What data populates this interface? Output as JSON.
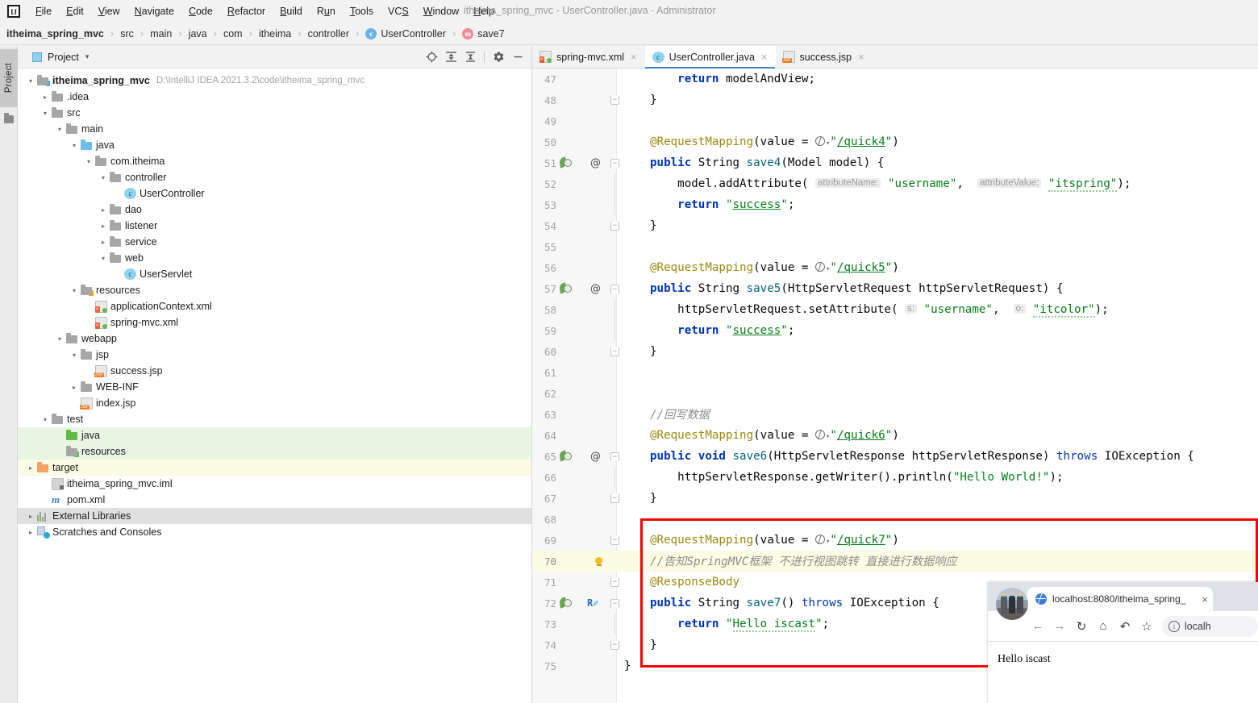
{
  "window": {
    "title": "itheima_spring_mvc - UserController.java - Administrator",
    "logo_text": "IJ"
  },
  "menubar": {
    "items": [
      {
        "label": "File",
        "mnemonic": "F"
      },
      {
        "label": "Edit",
        "mnemonic": "E"
      },
      {
        "label": "View",
        "mnemonic": "V"
      },
      {
        "label": "Navigate",
        "mnemonic": "N"
      },
      {
        "label": "Code",
        "mnemonic": "C"
      },
      {
        "label": "Refactor",
        "mnemonic": "R"
      },
      {
        "label": "Build",
        "mnemonic": "B"
      },
      {
        "label": "Run",
        "mnemonic": "u"
      },
      {
        "label": "Tools",
        "mnemonic": "T"
      },
      {
        "label": "VCS",
        "mnemonic": "S"
      },
      {
        "label": "Window",
        "mnemonic": "W"
      },
      {
        "label": "Help",
        "mnemonic": "H"
      }
    ]
  },
  "breadcrumb": {
    "items": [
      {
        "label": "itheima_spring_mvc",
        "bold": true,
        "badge": ""
      },
      {
        "label": "src",
        "bold": false,
        "badge": ""
      },
      {
        "label": "main",
        "bold": false,
        "badge": ""
      },
      {
        "label": "java",
        "bold": false,
        "badge": ""
      },
      {
        "label": "com",
        "bold": false,
        "badge": ""
      },
      {
        "label": "itheima",
        "bold": false,
        "badge": ""
      },
      {
        "label": "controller",
        "bold": false,
        "badge": ""
      },
      {
        "label": "UserController",
        "bold": false,
        "badge": "c"
      },
      {
        "label": "save7",
        "bold": false,
        "badge": "m"
      }
    ]
  },
  "left_strip": {
    "project_tab_label": "Project"
  },
  "project_panel": {
    "title": "Project",
    "caret": "▾",
    "toolbar": [
      {
        "name": "locate-icon",
        "glyph": "⊕"
      },
      {
        "name": "expand-all-icon",
        "glyph": "≡"
      },
      {
        "name": "collapse-all-icon",
        "glyph": "≡"
      },
      {
        "name": "settings-gear-icon",
        "glyph": "⚙"
      },
      {
        "name": "hide-icon",
        "glyph": "—"
      }
    ],
    "tree": [
      {
        "indent": 0,
        "arrow": "⌄",
        "icon": "folder-src",
        "label": "itheima_spring_mvc",
        "bold": true,
        "path": "D:\\IntelliJ IDEA 2021.3.2\\code\\itheima_spring_mvc",
        "bg": ""
      },
      {
        "indent": 1,
        "arrow": "›",
        "icon": "folder",
        "label": ".idea",
        "bold": false,
        "path": "",
        "bg": ""
      },
      {
        "indent": 1,
        "arrow": "⌄",
        "icon": "folder",
        "label": "src",
        "bold": false,
        "path": "",
        "bg": ""
      },
      {
        "indent": 2,
        "arrow": "⌄",
        "icon": "folder",
        "label": "main",
        "bold": false,
        "path": "",
        "bg": ""
      },
      {
        "indent": 3,
        "arrow": "⌄",
        "icon": "folder-blue",
        "label": "java",
        "bold": false,
        "path": "",
        "bg": ""
      },
      {
        "indent": 4,
        "arrow": "⌄",
        "icon": "package",
        "label": "com.itheima",
        "bold": false,
        "path": "",
        "bg": ""
      },
      {
        "indent": 5,
        "arrow": "⌄",
        "icon": "package",
        "label": "controller",
        "bold": false,
        "path": "",
        "bg": ""
      },
      {
        "indent": 6,
        "arrow": "",
        "icon": "class",
        "label": "UserController",
        "bold": false,
        "path": "",
        "bg": ""
      },
      {
        "indent": 5,
        "arrow": "›",
        "icon": "package",
        "label": "dao",
        "bold": false,
        "path": "",
        "bg": ""
      },
      {
        "indent": 5,
        "arrow": "›",
        "icon": "package",
        "label": "listener",
        "bold": false,
        "path": "",
        "bg": ""
      },
      {
        "indent": 5,
        "arrow": "›",
        "icon": "package",
        "label": "service",
        "bold": false,
        "path": "",
        "bg": ""
      },
      {
        "indent": 5,
        "arrow": "⌄",
        "icon": "package",
        "label": "web",
        "bold": false,
        "path": "",
        "bg": ""
      },
      {
        "indent": 6,
        "arrow": "",
        "icon": "class",
        "label": "UserServlet",
        "bold": false,
        "path": "",
        "bg": ""
      },
      {
        "indent": 3,
        "arrow": "⌄",
        "icon": "folder-res",
        "label": "resources",
        "bold": false,
        "path": "",
        "bg": ""
      },
      {
        "indent": 4,
        "arrow": "",
        "icon": "xml",
        "label": "applicationContext.xml",
        "bold": false,
        "path": "",
        "bg": ""
      },
      {
        "indent": 4,
        "arrow": "",
        "icon": "xml",
        "label": "spring-mvc.xml",
        "bold": false,
        "path": "",
        "bg": ""
      },
      {
        "indent": 2,
        "arrow": "⌄",
        "icon": "webapp",
        "label": "webapp",
        "bold": false,
        "path": "",
        "bg": ""
      },
      {
        "indent": 3,
        "arrow": "⌄",
        "icon": "folder",
        "label": "jsp",
        "bold": false,
        "path": "",
        "bg": ""
      },
      {
        "indent": 4,
        "arrow": "",
        "icon": "jsp",
        "label": "success.jsp",
        "bold": false,
        "path": "",
        "bg": ""
      },
      {
        "indent": 3,
        "arrow": "›",
        "icon": "folder",
        "label": "WEB-INF",
        "bold": false,
        "path": "",
        "bg": ""
      },
      {
        "indent": 3,
        "arrow": "",
        "icon": "jsp",
        "label": "index.jsp",
        "bold": false,
        "path": "",
        "bg": ""
      },
      {
        "indent": 1,
        "arrow": "⌄",
        "icon": "folder",
        "label": "test",
        "bold": false,
        "path": "",
        "bg": ""
      },
      {
        "indent": 2,
        "arrow": "",
        "icon": "folder-green",
        "label": "java",
        "bold": false,
        "path": "",
        "bg": "green"
      },
      {
        "indent": 2,
        "arrow": "",
        "icon": "folder-testres",
        "label": "resources",
        "bold": false,
        "path": "",
        "bg": "green"
      },
      {
        "indent": 0,
        "arrow": "›",
        "icon": "folder-orange",
        "label": "target",
        "bold": false,
        "path": "",
        "bg": "yellow"
      },
      {
        "indent": 1,
        "arrow": "",
        "icon": "iml",
        "label": "itheima_spring_mvc.iml",
        "bold": false,
        "path": "",
        "bg": ""
      },
      {
        "indent": 1,
        "arrow": "",
        "icon": "maven",
        "label": "pom.xml",
        "bold": false,
        "path": "",
        "bg": ""
      },
      {
        "indent": -1,
        "arrow": "›",
        "icon": "libs",
        "label": "External Libraries",
        "bold": false,
        "path": "",
        "bg": "gray"
      },
      {
        "indent": -1,
        "arrow": "›",
        "icon": "scratch",
        "label": "Scratches and Consoles",
        "bold": false,
        "path": "",
        "bg": ""
      }
    ]
  },
  "editor": {
    "tabs": [
      {
        "label": "spring-mvc.xml",
        "icon": "xml",
        "active": false,
        "close": "×"
      },
      {
        "label": "UserController.java",
        "icon": "class",
        "active": true,
        "close": "×"
      },
      {
        "label": "success.jsp",
        "icon": "jsp",
        "active": false,
        "close": "×"
      }
    ],
    "first_line_number": 47,
    "lines": [
      {
        "n": "47",
        "gutter": "",
        "fold": "",
        "highlight": false
      },
      {
        "n": "48",
        "gutter": "",
        "fold": "bot",
        "highlight": false
      },
      {
        "n": "49",
        "gutter": "",
        "fold": "",
        "highlight": false
      },
      {
        "n": "50",
        "gutter": "",
        "fold": "",
        "highlight": false
      },
      {
        "n": "51",
        "gutter": "bean-at",
        "fold": "top",
        "highlight": false
      },
      {
        "n": "52",
        "gutter": "",
        "fold": "bar",
        "highlight": false
      },
      {
        "n": "53",
        "gutter": "",
        "fold": "bar",
        "highlight": false
      },
      {
        "n": "54",
        "gutter": "",
        "fold": "bot",
        "highlight": false
      },
      {
        "n": "55",
        "gutter": "",
        "fold": "",
        "highlight": false
      },
      {
        "n": "56",
        "gutter": "",
        "fold": "",
        "highlight": false
      },
      {
        "n": "57",
        "gutter": "bean-at",
        "fold": "top",
        "highlight": false
      },
      {
        "n": "58",
        "gutter": "",
        "fold": "bar",
        "highlight": false
      },
      {
        "n": "59",
        "gutter": "",
        "fold": "bar",
        "highlight": false
      },
      {
        "n": "60",
        "gutter": "",
        "fold": "bot",
        "highlight": false
      },
      {
        "n": "61",
        "gutter": "",
        "fold": "",
        "highlight": false
      },
      {
        "n": "62",
        "gutter": "",
        "fold": "",
        "highlight": false
      },
      {
        "n": "63",
        "gutter": "",
        "fold": "",
        "highlight": false
      },
      {
        "n": "64",
        "gutter": "",
        "fold": "",
        "highlight": false
      },
      {
        "n": "65",
        "gutter": "bean-at",
        "fold": "top",
        "highlight": false
      },
      {
        "n": "66",
        "gutter": "",
        "fold": "bar",
        "highlight": false
      },
      {
        "n": "67",
        "gutter": "",
        "fold": "bot",
        "highlight": false
      },
      {
        "n": "68",
        "gutter": "",
        "fold": "",
        "highlight": false
      },
      {
        "n": "69",
        "gutter": "",
        "fold": "bot",
        "highlight": false
      },
      {
        "n": "70",
        "gutter": "bulb",
        "fold": "",
        "highlight": true
      },
      {
        "n": "71",
        "gutter": "",
        "fold": "bot",
        "highlight": false
      },
      {
        "n": "72",
        "gutter": "bean-rm",
        "fold": "top",
        "highlight": false
      },
      {
        "n": "73",
        "gutter": "",
        "fold": "bar",
        "highlight": false
      },
      {
        "n": "74",
        "gutter": "",
        "fold": "bot",
        "highlight": false
      },
      {
        "n": "75",
        "gutter": "",
        "fold": "",
        "highlight": false
      }
    ],
    "code_text": {
      "l47": "        return modelAndView;",
      "l48": "    }",
      "l49": "",
      "l50": "    @RequestMapping(value = \"/quick4\")",
      "l51": "    public String save4(Model model) {",
      "l52": "        model.addAttribute( attributeName: \"username\",  attributeValue: \"itspring\");",
      "l53": "        return \"success\";",
      "l54": "    }",
      "l55": "",
      "l56": "    @RequestMapping(value = \"/quick5\")",
      "l57": "    public String save5(HttpServletRequest httpServletRequest) {",
      "l58": "        httpServletRequest.setAttribute( s: \"username\",  o: \"itcolor\");",
      "l59": "        return \"success\";",
      "l60": "    }",
      "l61": "",
      "l62": "",
      "l63": "    //回写数据",
      "l64": "    @RequestMapping(value = \"/quick6\")",
      "l65": "    public void save6(HttpServletResponse httpServletResponse) throws IOException {",
      "l66": "        httpServletResponse.getWriter().println(\"Hello World!\");",
      "l67": "    }",
      "l68": "",
      "l69": "    @RequestMapping(value = \"/quick7\")",
      "l70": "    //告知SpringMVC框架 不进行视图跳转 直接进行数据响应",
      "l71": "    @ResponseBody",
      "l72": "    public String save7() throws IOException {",
      "l73": "        return \"Hello iscast\";",
      "l74": "    }",
      "l75": "}"
    },
    "tokens": {
      "return": "return",
      "public": "public",
      "void": "void",
      "throws": "throws",
      "modelAndView": "modelAndView",
      "brace_close": "}",
      "request_mapping": "@RequestMapping",
      "response_body": "@ResponseBody",
      "value_eq": "(value = ",
      "quick4": "\"/quick4\"",
      "quick5": "\"/quick5\"",
      "quick6": "\"/quick6\"",
      "quick7": "\"/quick7\"",
      "paren_close": ")",
      "string_class": "String",
      "save4": "save4",
      "save5": "save5",
      "save6": "save6",
      "save7": "save7",
      "model_param": "(Model model) {",
      "model_add": "model.addAttribute(",
      "hint_attr_name": "attributeName:",
      "hint_attr_value": "attributeValue:",
      "str_username": "\"username\"",
      "str_itspring": "\"itspring\"",
      "str_success": "\"success\"",
      "str_itcolor": "\"itcolor\"",
      "str_hello_world": "\"Hello World!\"",
      "str_hello_iscast": "\"Hello iscast\"",
      "req_param": "(HttpServletRequest httpServletRequest) {",
      "req_setattr": "httpServletRequest.setAttribute(",
      "hint_s": "s:",
      "hint_o": "o:",
      "resp_param": "(HttpServletResponse httpServletResponse)",
      "io_exception": "IOException {",
      "resp_writer": "httpServletResponse.getWriter().println(",
      "comment_writeback": "//回写数据",
      "comment_notify": "//告知SpringMVC框架 不进行视图跳转 直接进行数据响应",
      "save7_sig": "() throws ",
      "semi": ";",
      "comma": ",",
      "paren_semi": ");"
    }
  },
  "browser": {
    "tab_title": "localhost:8080/itheima_spring_",
    "tab_close": "×",
    "nav": {
      "back": "←",
      "forward": "→",
      "reload": "↻",
      "home": "⌂",
      "history": "↶",
      "bookmark": "☆"
    },
    "omnibox": {
      "info_glyph": "i",
      "url": "localh"
    },
    "page_text": "Hello iscast"
  },
  "colors": {
    "accent_blue": "#4083c9",
    "annotation": "#9e880d",
    "string": "#067d17",
    "keyword": "#0033b3",
    "comment": "#8c8c8c",
    "method": "#00627a",
    "red_highlight": "#ff0000",
    "selection_green": "#e9f5e3",
    "selection_yellow": "#fcfbe3"
  }
}
